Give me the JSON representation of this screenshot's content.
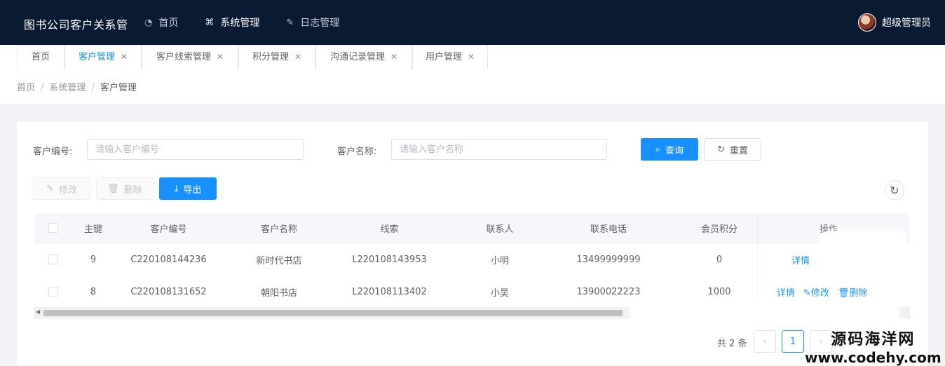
{
  "app": {
    "title": "图书公司客户关系管"
  },
  "topnav": [
    {
      "label": "首页",
      "icon": "dashboard-icon"
    },
    {
      "label": "系统管理",
      "icon": "grid-icon"
    },
    {
      "label": "日志管理",
      "icon": "edit-icon"
    }
  ],
  "user": {
    "name": "超级管理员"
  },
  "tabs": [
    {
      "label": "首页"
    },
    {
      "label": "客户管理"
    },
    {
      "label": "客户线索管理"
    },
    {
      "label": "积分管理"
    },
    {
      "label": "沟通记录管理"
    },
    {
      "label": "用户管理"
    }
  ],
  "breadcrumb": {
    "items": [
      "首页",
      "系统管理",
      "客户管理"
    ]
  },
  "search": {
    "code_label": "客户编号:",
    "code_placeholder": "请输入客户编号",
    "name_label": "客户名称:",
    "name_placeholder": "请输入客户名称",
    "query_label": "查询",
    "reset_label": "重置"
  },
  "toolbar": {
    "edit_label": "修改",
    "delete_label": "删除",
    "export_label": "导出"
  },
  "table": {
    "headers": [
      "主键",
      "客户编号",
      "客户名称",
      "线索",
      "联系人",
      "联系电话",
      "会员积分",
      "操作"
    ],
    "rows": [
      {
        "id": "9",
        "code": "C220108144236",
        "name": "新时代书店",
        "lead": "L220108143953",
        "contact": "小明",
        "phone": "13499999999",
        "points": "0"
      },
      {
        "id": "8",
        "code": "C220108131652",
        "name": "朝阳书店",
        "lead": "L220108113402",
        "contact": "小吴",
        "phone": "13900022223",
        "points": "1000"
      }
    ],
    "actions": {
      "detail": "详情",
      "edit": "修改",
      "delete": "删除"
    }
  },
  "pagination": {
    "total_text": "共 2 条",
    "current_page": "1"
  },
  "watermark": {
    "line1": "源码海洋网",
    "line2": "www.codehy.com"
  }
}
